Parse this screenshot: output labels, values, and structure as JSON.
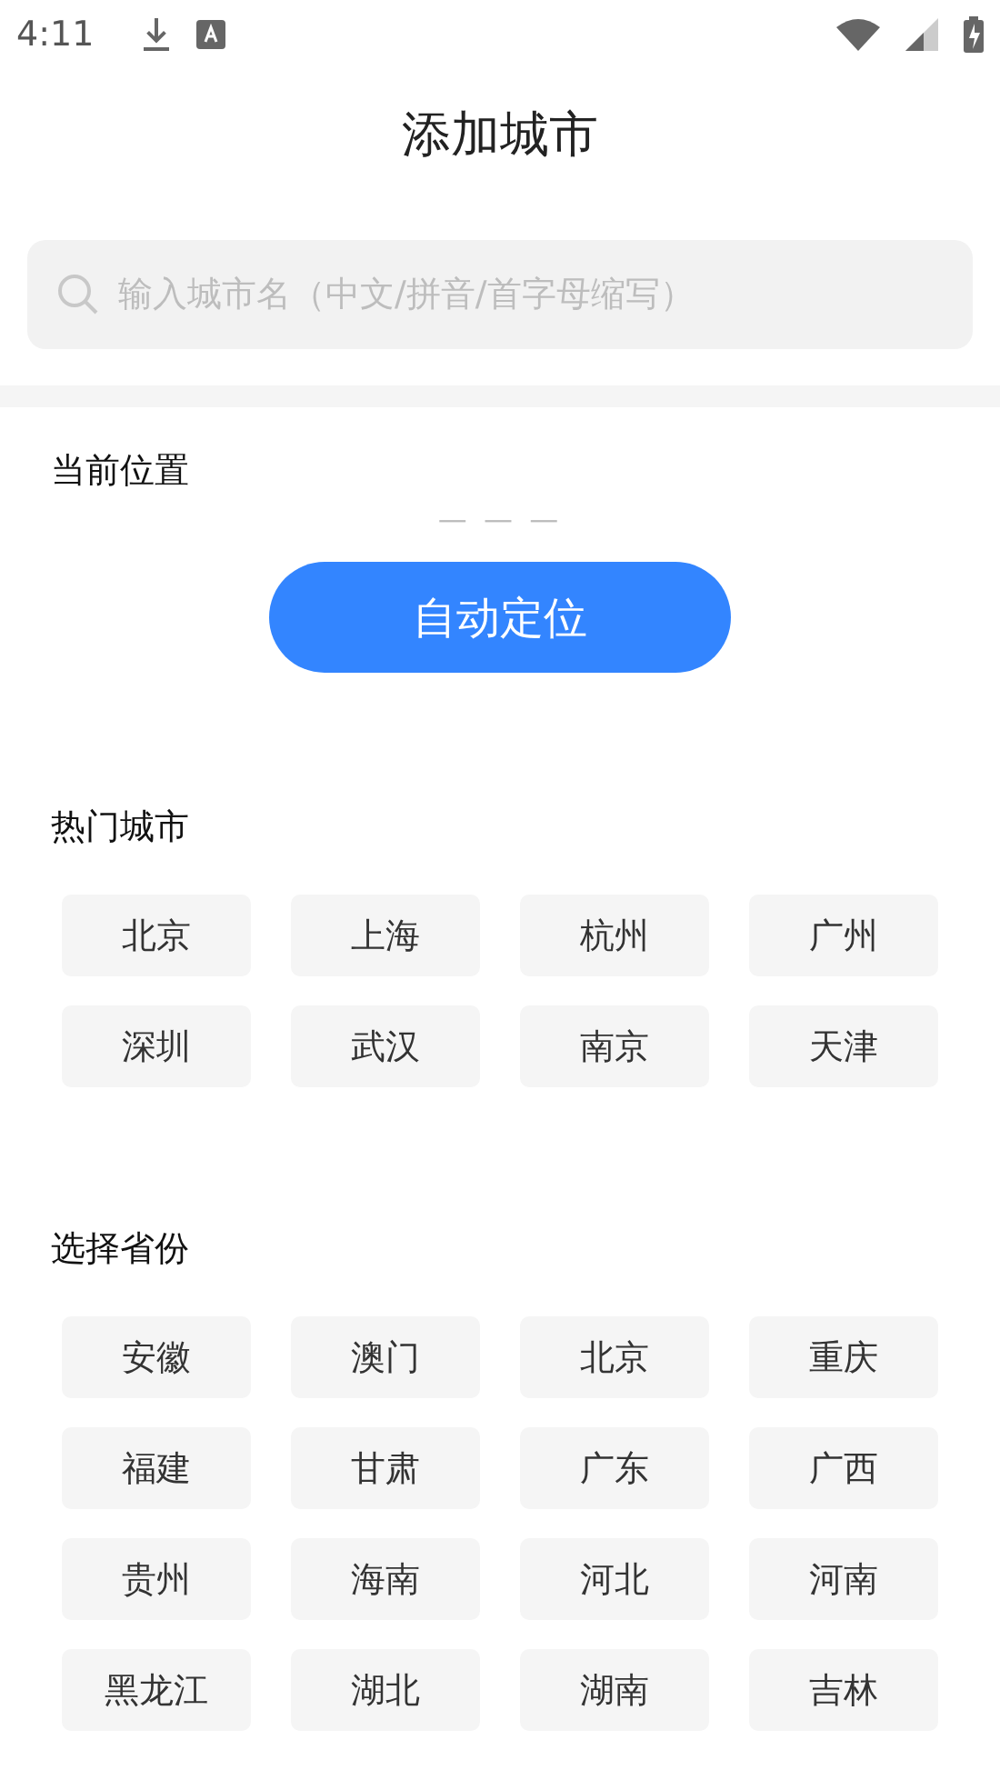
{
  "status_bar": {
    "time": "4:11"
  },
  "title": "添加城市",
  "search": {
    "placeholder": "输入城市名（中文/拼音/首字母缩写）"
  },
  "current_location": {
    "heading": "当前位置",
    "value": "— — —",
    "button": "自动定位"
  },
  "hot_cities": {
    "heading": "热门城市",
    "items": [
      "北京",
      "上海",
      "杭州",
      "广州",
      "深圳",
      "武汉",
      "南京",
      "天津"
    ]
  },
  "provinces": {
    "heading": "选择省份",
    "items": [
      "安徽",
      "澳门",
      "北京",
      "重庆",
      "福建",
      "甘肃",
      "广东",
      "广西",
      "贵州",
      "海南",
      "河北",
      "河南",
      "黑龙江",
      "湖北",
      "湖南",
      "吉林"
    ]
  }
}
